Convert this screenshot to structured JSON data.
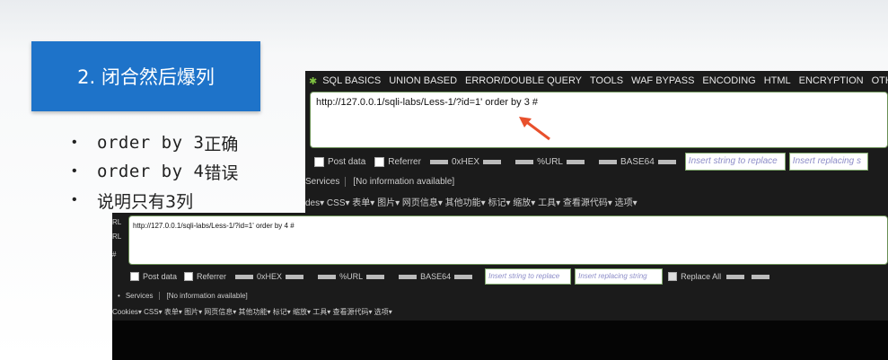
{
  "slide": {
    "title": "2.  闭合然后爆列",
    "bullets": [
      {
        "mono": "order by 3 ",
        "cjk": "正确"
      },
      {
        "mono": "order by 4 ",
        "cjk": "错误"
      },
      {
        "mono": "",
        "cjk": "说明只有3列"
      }
    ]
  },
  "panel1": {
    "menu": [
      "SQL BASICS",
      "UNION BASED",
      "ERROR/DOUBLE QUERY",
      "TOOLS",
      "WAF BYPASS",
      "ENCODING",
      "HTML",
      "ENCRYPTION",
      "OTHER"
    ],
    "url": "http://127.0.0.1/sqli-labs/Less-1/?id=1' order by 3 #",
    "post_data": "Post data",
    "referrer": "Referrer",
    "hex": "0xHEX",
    "url_enc": "%URL",
    "base64": "BASE64",
    "replace_placeholder": "Insert string to replace",
    "replacing_placeholder": "Insert replacing s",
    "services": "Services",
    "no_info": "[No information available]",
    "row3": "des▾  CSS▾  表单▾  图片▾  网页信息▾  其他功能▾  标记▾  缩放▾  工具▾  查看源代码▾  选项▾"
  },
  "panel2": {
    "side1": "RL",
    "side2": "RL",
    "side3": "#",
    "url": "http://127.0.0.1/sqli-labs/Less-1/?id=1' order by 4 #",
    "post_data": "Post data",
    "referrer": "Referrer",
    "hex": "0xHEX",
    "url_enc": "%URL",
    "base64": "BASE64",
    "replace_placeholder": "Insert string to replace",
    "replacing_placeholder": "Insert replacing string",
    "replace_all": "Replace All",
    "services": "Services",
    "no_info": "[No information available]",
    "row3": "Cookies▾  CSS▾  表单▾  图片▾  网页信息▾  其他功能▾  标记▾  缩放▾  工具▾  查看源代码▾  选项▾"
  },
  "colors": {
    "title_bg": "#1e73c9",
    "arrow": "#e8502c",
    "accent_green": "#7fc241"
  }
}
